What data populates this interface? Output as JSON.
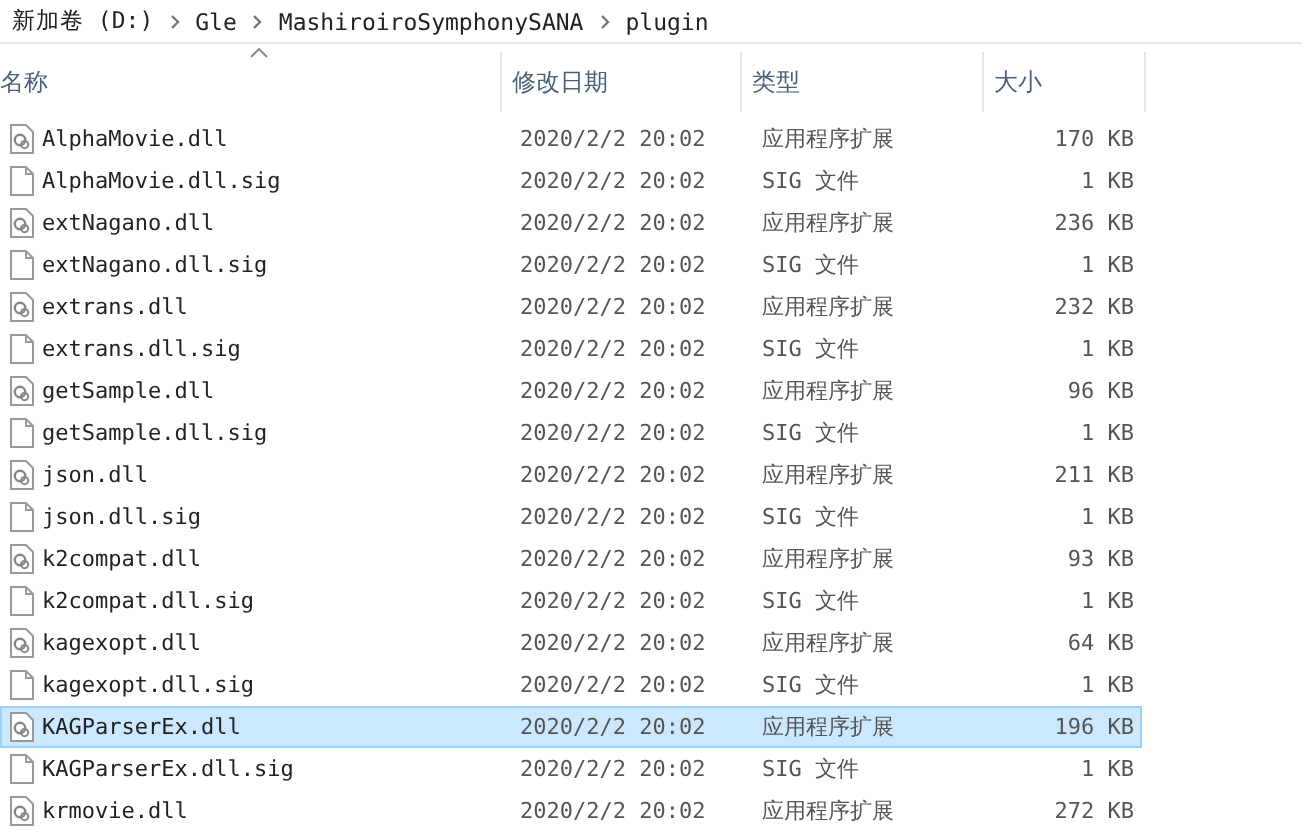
{
  "breadcrumb": [
    "新加卷 (D:)",
    "Gle",
    "MashiroiroSymphonySANA",
    "plugin"
  ],
  "columns": [
    {
      "label": "名称",
      "sorted": true
    },
    {
      "label": "修改日期",
      "sorted": false
    },
    {
      "label": "类型",
      "sorted": false
    },
    {
      "label": "大小",
      "sorted": false
    }
  ],
  "files": [
    {
      "name": "AlphaMovie.dll",
      "kind": "dll",
      "modified": "2020/2/2 20:02",
      "type": "应用程序扩展",
      "size": "170 KB",
      "selected": false
    },
    {
      "name": "AlphaMovie.dll.sig",
      "kind": "sig",
      "modified": "2020/2/2 20:02",
      "type": "SIG 文件",
      "size": "1 KB",
      "selected": false
    },
    {
      "name": "extNagano.dll",
      "kind": "dll",
      "modified": "2020/2/2 20:02",
      "type": "应用程序扩展",
      "size": "236 KB",
      "selected": false
    },
    {
      "name": "extNagano.dll.sig",
      "kind": "sig",
      "modified": "2020/2/2 20:02",
      "type": "SIG 文件",
      "size": "1 KB",
      "selected": false
    },
    {
      "name": "extrans.dll",
      "kind": "dll",
      "modified": "2020/2/2 20:02",
      "type": "应用程序扩展",
      "size": "232 KB",
      "selected": false
    },
    {
      "name": "extrans.dll.sig",
      "kind": "sig",
      "modified": "2020/2/2 20:02",
      "type": "SIG 文件",
      "size": "1 KB",
      "selected": false
    },
    {
      "name": "getSample.dll",
      "kind": "dll",
      "modified": "2020/2/2 20:02",
      "type": "应用程序扩展",
      "size": "96 KB",
      "selected": false
    },
    {
      "name": "getSample.dll.sig",
      "kind": "sig",
      "modified": "2020/2/2 20:02",
      "type": "SIG 文件",
      "size": "1 KB",
      "selected": false
    },
    {
      "name": "json.dll",
      "kind": "dll",
      "modified": "2020/2/2 20:02",
      "type": "应用程序扩展",
      "size": "211 KB",
      "selected": false
    },
    {
      "name": "json.dll.sig",
      "kind": "sig",
      "modified": "2020/2/2 20:02",
      "type": "SIG 文件",
      "size": "1 KB",
      "selected": false
    },
    {
      "name": "k2compat.dll",
      "kind": "dll",
      "modified": "2020/2/2 20:02",
      "type": "应用程序扩展",
      "size": "93 KB",
      "selected": false
    },
    {
      "name": "k2compat.dll.sig",
      "kind": "sig",
      "modified": "2020/2/2 20:02",
      "type": "SIG 文件",
      "size": "1 KB",
      "selected": false
    },
    {
      "name": "kagexopt.dll",
      "kind": "dll",
      "modified": "2020/2/2 20:02",
      "type": "应用程序扩展",
      "size": "64 KB",
      "selected": false
    },
    {
      "name": "kagexopt.dll.sig",
      "kind": "sig",
      "modified": "2020/2/2 20:02",
      "type": "SIG 文件",
      "size": "1 KB",
      "selected": false
    },
    {
      "name": "KAGParserEx.dll",
      "kind": "dll",
      "modified": "2020/2/2 20:02",
      "type": "应用程序扩展",
      "size": "196 KB",
      "selected": true
    },
    {
      "name": "KAGParserEx.dll.sig",
      "kind": "sig",
      "modified": "2020/2/2 20:02",
      "type": "SIG 文件",
      "size": "1 KB",
      "selected": false
    },
    {
      "name": "krmovie.dll",
      "kind": "dll",
      "modified": "2020/2/2 20:02",
      "type": "应用程序扩展",
      "size": "272 KB",
      "selected": false
    }
  ]
}
